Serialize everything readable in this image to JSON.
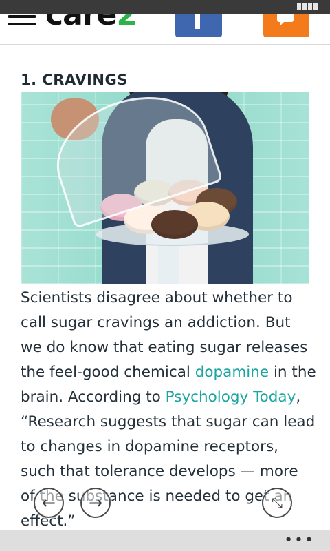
{
  "header": {
    "logo_text": "care",
    "logo_accent": "2",
    "brand_color": "#2db34a",
    "facebook_color": "#3f67b0",
    "comment_color": "#f47b1b"
  },
  "article": {
    "heading": "1. CRAVINGS",
    "p1": "Scientists disagree about whether to call sugar cravings an addiction. But we do know that eating sugar releases the feel-good chemical ",
    "link1": "dopamine",
    "p2": " in the brain. According to ",
    "link2": "Psychology Today",
    "p3": ", “Research suggests that sugar can lead to changes in dopamine receptors, such that tolerance develops — more of the substance is needed to get an effect.”",
    "link_color": "#1aa5a0"
  },
  "nav": {
    "back_glyph": "←",
    "forward_glyph": "→",
    "minimize_glyph": "⤡",
    "menu_glyph": "•••"
  },
  "icons": [
    "menu-icon",
    "facebook-icon",
    "comment-icon",
    "back-arrow-icon",
    "forward-arrow-icon",
    "minimize-icon",
    "more-options-icon",
    "battery-icon"
  ]
}
